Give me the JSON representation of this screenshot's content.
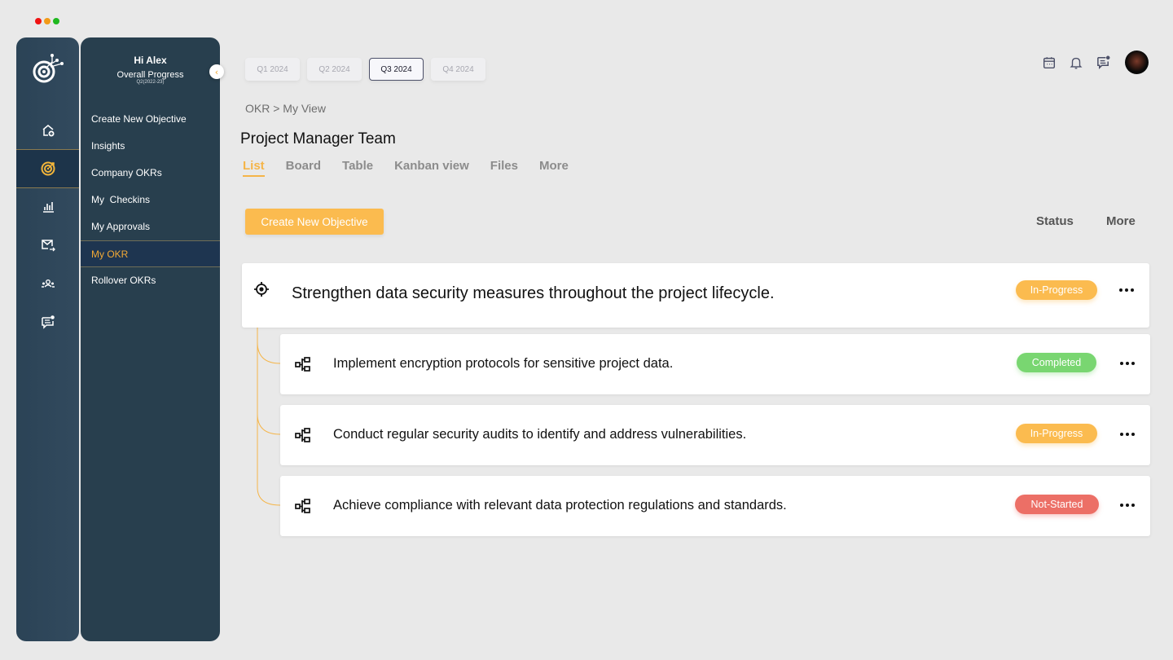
{
  "window": {
    "traffic_lights": [
      "close",
      "minimize",
      "maximize"
    ]
  },
  "rail": {
    "logo_icon": "target-network-icon",
    "items": [
      {
        "icon": "home-add-icon",
        "active": false
      },
      {
        "icon": "target-icon",
        "active": true
      },
      {
        "icon": "bar-chart-icon",
        "active": false
      },
      {
        "icon": "mail-forward-icon",
        "active": false
      },
      {
        "icon": "team-icon",
        "active": false
      },
      {
        "icon": "chat-notification-icon",
        "active": false
      }
    ]
  },
  "panel": {
    "greeting": "Hi Alex",
    "progress_label": "Overall Progress",
    "progress_period": "Q2(2022-23)",
    "collapse_icon": "chevron-left-icon",
    "menu": [
      {
        "label": "Create New Objective",
        "active": false
      },
      {
        "label": "Insights",
        "active": false
      },
      {
        "label": "Company OKRs",
        "active": false
      },
      {
        "label": "My  Checkins",
        "active": false
      },
      {
        "label": "My Approvals",
        "active": false
      },
      {
        "label": "My OKR",
        "active": true
      },
      {
        "label": "Rollover OKRs",
        "active": false
      }
    ]
  },
  "quarters": [
    {
      "label": "Q1 2024",
      "active": false
    },
    {
      "label": "Q2 2024",
      "active": false
    },
    {
      "label": "Q3 2024",
      "active": true
    },
    {
      "label": "Q4 2024",
      "active": false
    }
  ],
  "topbar": {
    "icons": [
      "calendar-icon",
      "bell-icon",
      "chat-notification-icon"
    ],
    "avatar": "user-avatar"
  },
  "breadcrumb": "OKR > My View",
  "page_title": "Project Manager Team",
  "tabs": [
    {
      "label": "List",
      "active": true
    },
    {
      "label": "Board",
      "active": false
    },
    {
      "label": "Table",
      "active": false
    },
    {
      "label": "Kanban view",
      "active": false
    },
    {
      "label": "Files",
      "active": false
    },
    {
      "label": "More",
      "active": false
    }
  ],
  "toolbar": {
    "create_label": "Create New Objective",
    "status_label": "Status",
    "more_label": "More"
  },
  "colors": {
    "accent": "#fbbb4f",
    "sidebar": "#283f4e",
    "in_progress": "#fbbb4f",
    "completed": "#79d671",
    "not_started": "#ec6f66"
  },
  "objective": {
    "title": "Strengthen data security measures throughout the project lifecycle.",
    "status": "In-Progress",
    "key_results": [
      {
        "title": "Implement encryption protocols for sensitive project data.",
        "status": "Completed"
      },
      {
        "title": "Conduct regular security audits to identify and address vulnerabilities.",
        "status": "In-Progress"
      },
      {
        "title": "Achieve compliance with relevant data protection regulations and standards.",
        "status": "Not-Started"
      }
    ]
  }
}
